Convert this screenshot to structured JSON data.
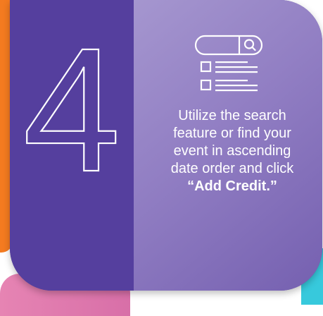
{
  "step": {
    "number": "4",
    "instruction_text": "Utilize the search feature or find your event in ascending date order and click",
    "instruction_emphasis": "“Add Credit.”"
  },
  "icons": {
    "search_graphic": "search-bar-list-icon"
  },
  "colors": {
    "card_left": "#553f9e",
    "card_right": "#917ec3",
    "accent_orange": "#f47b20",
    "accent_pink": "#e684b3",
    "accent_teal": "#37c9dc",
    "text": "#ffffff"
  }
}
